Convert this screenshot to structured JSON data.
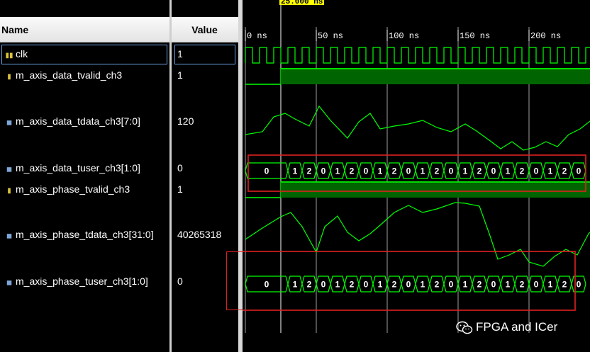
{
  "header": {
    "name_label": "Name",
    "value_label": "Value"
  },
  "cursor": {
    "label": "25.000 ns"
  },
  "timeline": {
    "ticks": [
      {
        "label": "0 ns",
        "ns": 0
      },
      {
        "label": "50 ns",
        "ns": 50
      },
      {
        "label": "100 ns",
        "ns": 100
      },
      {
        "label": "150 ns",
        "ns": 150
      },
      {
        "label": "200 ns",
        "ns": 200
      }
    ]
  },
  "signals": [
    {
      "name": "clk",
      "value": "1",
      "type": "bit"
    },
    {
      "name": "m_axis_data_tvalid_ch3",
      "value": "1",
      "type": "bit"
    },
    {
      "name": "m_axis_data_tdata_ch3[7:0]",
      "value": "120",
      "type": "bus"
    },
    {
      "name": "m_axis_data_tuser_ch3[1:0]",
      "value": "0",
      "type": "bus"
    },
    {
      "name": "m_axis_phase_tvalid_ch3",
      "value": "1",
      "type": "bit"
    },
    {
      "name": "m_axis_phase_tdata_ch3[31:0]",
      "value": "40265318",
      "type": "bus"
    },
    {
      "name": "m_axis_phase_tuser_ch3[1:0]",
      "value": "0",
      "type": "bus"
    }
  ],
  "tuser_sequence": [
    "0",
    "1",
    "2",
    "0",
    "1",
    "2",
    "0",
    "1",
    "2",
    "0",
    "1",
    "2",
    "0",
    "1",
    "2",
    "0",
    "1",
    "2",
    "0",
    "1",
    "2",
    "0"
  ],
  "colors": {
    "wave": "#00ff00",
    "valid_fill": "#006400",
    "highlight": "#e02020",
    "gridline": "#c8c8c8"
  },
  "watermark": {
    "text": "FPGA and ICer",
    "icon": "wechat-icon"
  }
}
